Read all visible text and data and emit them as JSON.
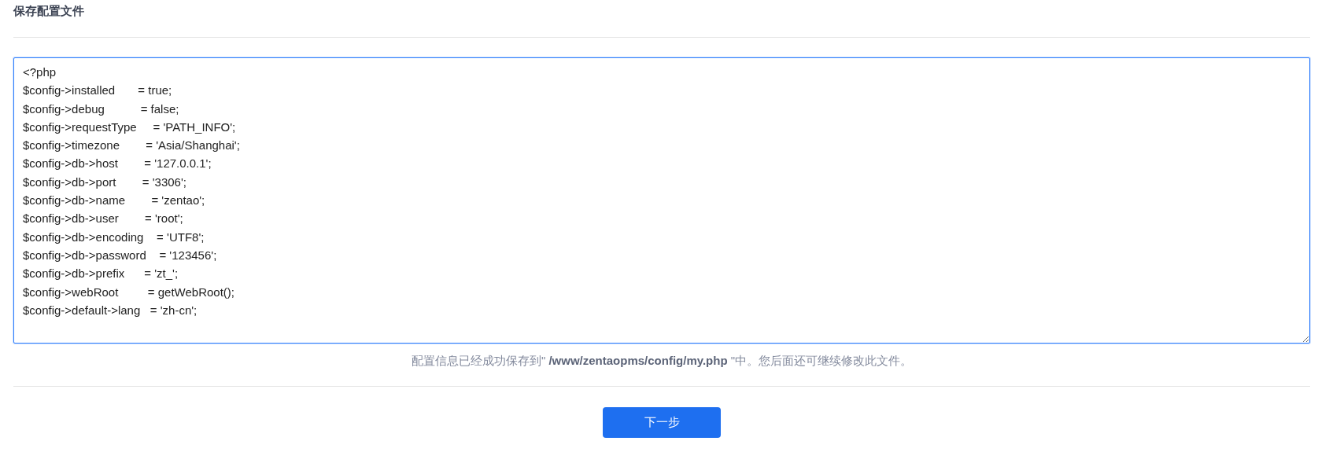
{
  "title": "保存配置文件",
  "config_file": {
    "lines": [
      "<?php",
      "$config->installed       = true;",
      "$config->debug           = false;",
      "$config->requestType     = 'PATH_INFO';",
      "$config->timezone        = 'Asia/Shanghai';",
      "$config->db->host        = '127.0.0.1';",
      "$config->db->port        = '3306';",
      "$config->db->name        = 'zentao';",
      "$config->db->user        = 'root';",
      "$config->db->encoding    = 'UTF8';",
      "$config->db->password    = '123456';",
      "$config->db->prefix      = 'zt_';",
      "$config->webRoot         = getWebRoot();",
      "$config->default->lang   = 'zh-cn';"
    ]
  },
  "message": "配置信息已经成功保存到\" **/www/zentaopms/config/my.php** \"中。您后面还可继续修改此文件。",
  "buttons": [
    "下一步"
  ]
}
